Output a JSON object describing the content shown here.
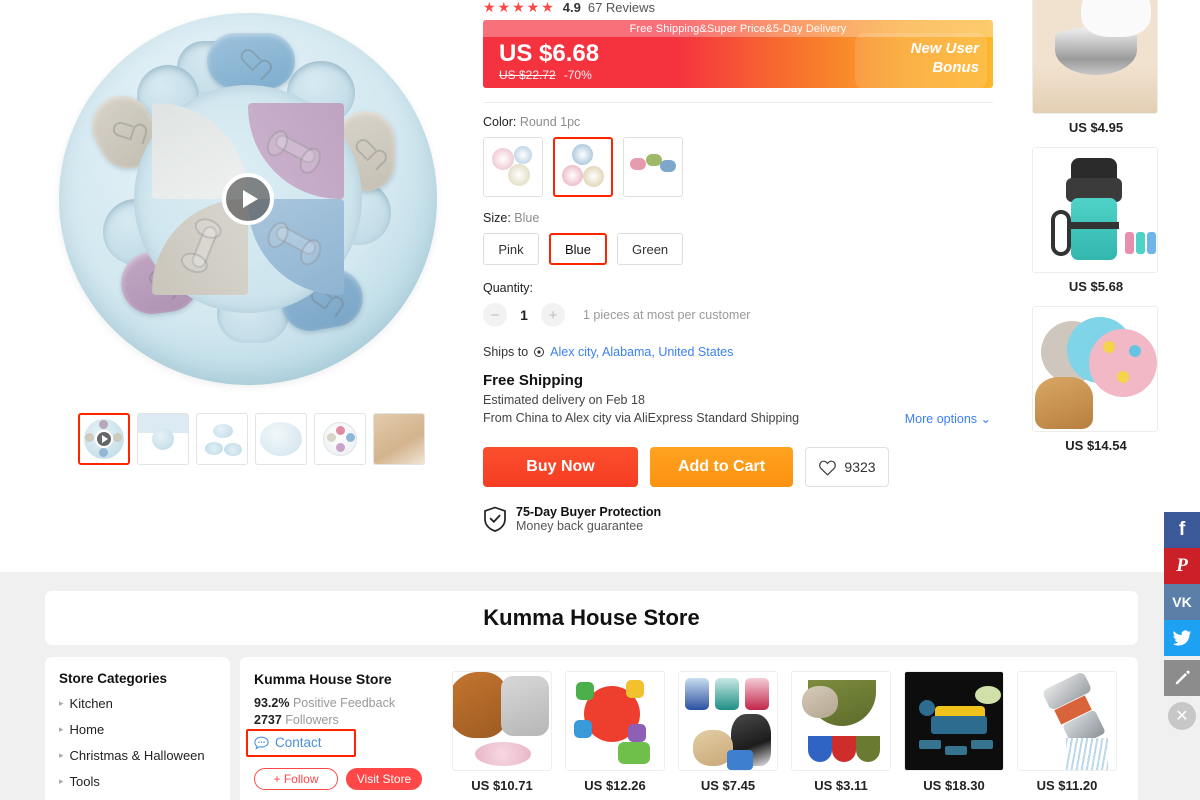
{
  "product": {
    "rating": {
      "stars": "★★★★★",
      "value": "4.9",
      "reviews": "67 Reviews"
    },
    "banner": {
      "promo_text": "Free Shipping&Super Price&5-Day Delivery",
      "price": "US $6.68",
      "old_price": "US $22.72",
      "discount": "-70%",
      "new_user_line1": "New User",
      "new_user_line2": "Bonus"
    },
    "color": {
      "label": "Color:",
      "value": "Round 1pc",
      "selected_index": 1,
      "options": [
        "round-set-mixed",
        "round-3pc",
        "bone-shape-set"
      ]
    },
    "size": {
      "label": "Size:",
      "value": "Blue",
      "selected_index": 1,
      "options": [
        "Pink",
        "Blue",
        "Green"
      ]
    },
    "quantity": {
      "label": "Quantity:",
      "value": "1",
      "minus": "−",
      "plus": "+",
      "note": "1 pieces at most per customer"
    },
    "ships_to": {
      "label": "Ships to",
      "destination": "Alex city, Alabama, United States"
    },
    "shipping": {
      "title": "Free Shipping",
      "estimate": "Estimated delivery on Feb 18",
      "route": "From China to Alex city via AliExpress Standard Shipping",
      "more_options": "More options"
    },
    "actions": {
      "buy_now": "Buy Now",
      "add_to_cart": "Add to Cart",
      "wishlist_count": "9323"
    },
    "protection": {
      "title": "75-Day Buyer Protection",
      "subtitle": "Money back guarantee"
    },
    "thumbnails": [
      {
        "name": "video-thumb",
        "selected": true
      },
      {
        "name": "infographic-thumb",
        "selected": false
      },
      {
        "name": "two-discs-thumb",
        "selected": false
      },
      {
        "name": "white-disc-thumb",
        "selected": false
      },
      {
        "name": "paw-toy-thumb",
        "selected": false
      },
      {
        "name": "lifestyle-thumb",
        "selected": false
      }
    ]
  },
  "recommendations": [
    {
      "name": "cat-water-bowl",
      "price": "US $4.95"
    },
    {
      "name": "pet-water-bottle",
      "price": "US $5.68"
    },
    {
      "name": "puzzle-discs-set",
      "price": "US $14.54"
    }
  ],
  "store": {
    "banner_title": "Kumma House Store",
    "categories_title": "Store Categories",
    "categories": [
      "Kitchen",
      "Home",
      "Christmas & Halloween",
      "Tools"
    ],
    "name": "Kumma House Store",
    "feedback_value": "93.2%",
    "feedback_label": "Positive Feedback",
    "followers_value": "2737",
    "followers_label": "Followers",
    "contact": "Contact",
    "follow": "+ Follow",
    "visit": "Visit Store",
    "products": [
      {
        "name": "dog-puzzle-feeder",
        "price": "US $10.71"
      },
      {
        "name": "colorful-treat-ball",
        "price": "US $12.26"
      },
      {
        "name": "paw-cleaner-cup",
        "price": "US $7.45"
      },
      {
        "name": "pet-grooming-hammock",
        "price": "US $3.11"
      },
      {
        "name": "vegetable-slicer",
        "price": "US $18.30"
      },
      {
        "name": "shower-head",
        "price": "US $11.20"
      }
    ]
  },
  "social": [
    {
      "name": "facebook",
      "glyph": "f",
      "color": "#3b5998"
    },
    {
      "name": "pinterest",
      "glyph": "𝑃",
      "color": "#cb2027"
    },
    {
      "name": "vk",
      "glyph": "вк",
      "color": "#5b7fa6"
    },
    {
      "name": "twitter",
      "glyph": "✈",
      "color": "#1da1f2"
    },
    {
      "name": "edit",
      "glyph": "✎",
      "color": "#8c8c8c"
    }
  ],
  "social_close": "✕",
  "colors": {
    "accent_red": "#ff2400",
    "brand_orange": "#fd9211",
    "link_blue": "#3b7ff5"
  }
}
